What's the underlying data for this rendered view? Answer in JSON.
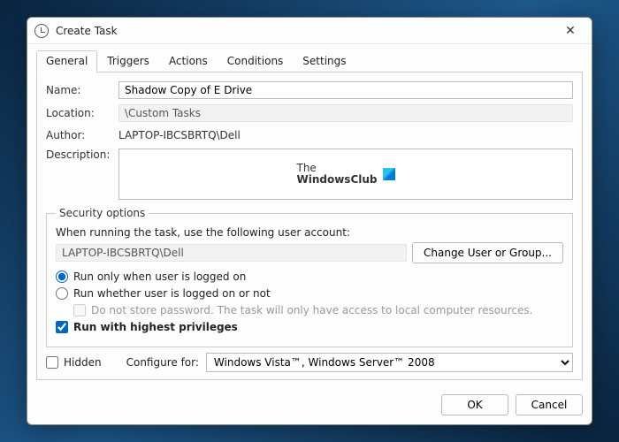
{
  "window": {
    "title": "Create Task",
    "close": "✕"
  },
  "tabs": {
    "general": "General",
    "triggers": "Triggers",
    "actions": "Actions",
    "conditions": "Conditions",
    "settings": "Settings"
  },
  "general": {
    "name_label": "Name:",
    "name_value": "Shadow Copy of E Drive",
    "location_label": "Location:",
    "location_value": "\\Custom Tasks",
    "author_label": "Author:",
    "author_value": "LAPTOP-IBCSBRTQ\\Dell",
    "description_label": "Description:",
    "brand_line1": "The",
    "brand_line2": "WindowsClub"
  },
  "security": {
    "legend": "Security options",
    "run_as_label": "When running the task, use the following user account:",
    "account": "LAPTOP-IBCSBRTQ\\Dell",
    "change_button": "Change User or Group...",
    "opt_logged_on": "Run only when user is logged on",
    "opt_whether": "Run whether user is logged on or not",
    "no_store_pw": "Do not store password.  The task will only have access to local computer resources.",
    "highest_priv": "Run with highest privileges"
  },
  "bottom": {
    "hidden_label": "Hidden",
    "configure_label": "Configure for:",
    "configure_value": "Windows Vista™, Windows Server™ 2008"
  },
  "footer": {
    "ok": "OK",
    "cancel": "Cancel"
  }
}
